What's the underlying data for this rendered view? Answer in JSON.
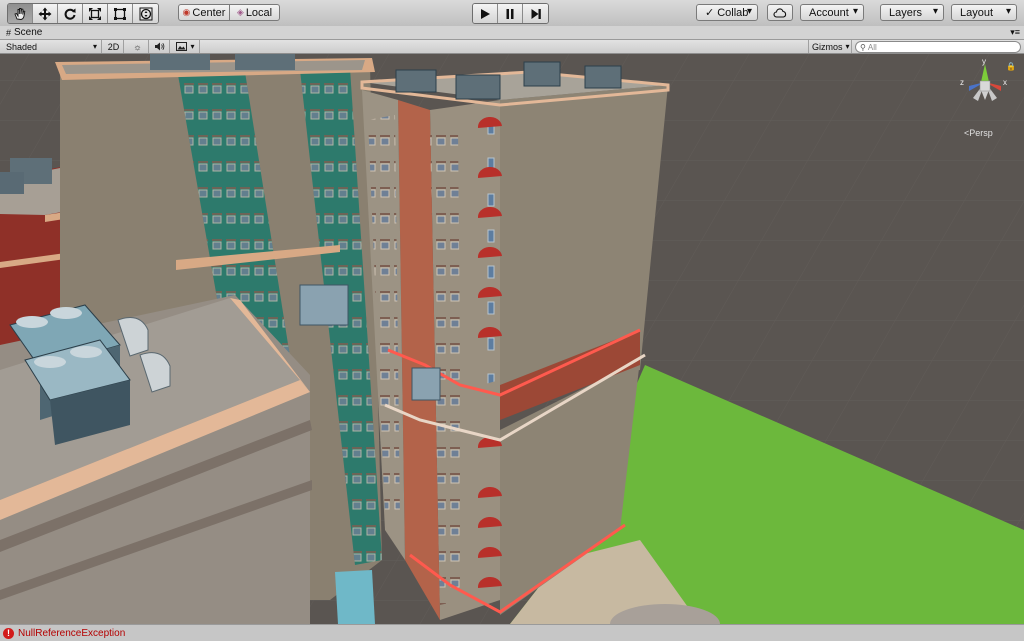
{
  "toolbar": {
    "pivot_label": "Center",
    "rotation_label": "Local",
    "collab_label": "Collab",
    "account_label": "Account",
    "layers_label": "Layers",
    "layout_label": "Layout"
  },
  "scene": {
    "tab_label": "Scene",
    "shading_mode": "Shaded",
    "mode_2d_label": "2D",
    "gizmos_label": "Gizmos",
    "search_placeholder": "All",
    "projection_label": "Persp",
    "axis_y": "y",
    "axis_x": "x",
    "axis_z": "z"
  },
  "status": {
    "message": "NullReferenceException"
  },
  "colors": {
    "ground": "#5a5551",
    "lawn": "#6cb83c",
    "tower_wall": "#8d8474",
    "trim": "#e3b898",
    "highlight": "#ff5a4e",
    "teal": "#2d7a6c",
    "brick": "#8f3028"
  }
}
